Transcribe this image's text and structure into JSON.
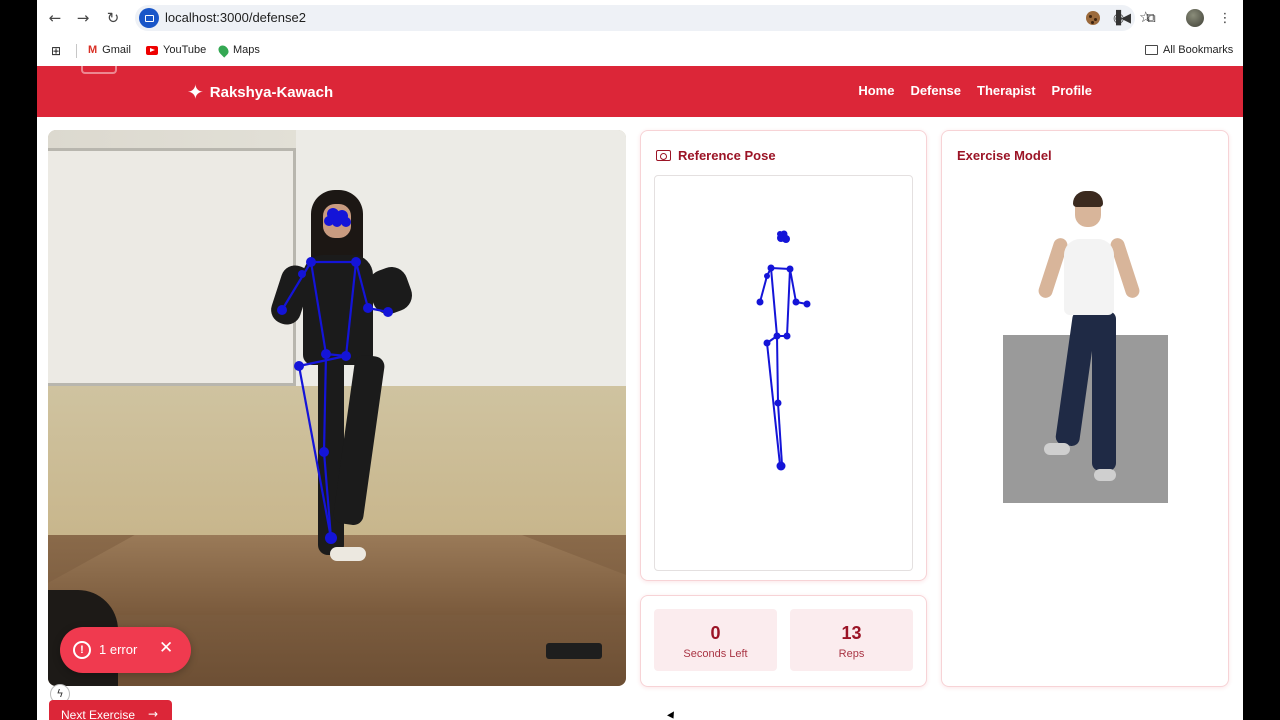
{
  "browser": {
    "url": "localhost:3000/defense2",
    "bookmarks": [
      {
        "label": "Gmail",
        "icon": "gmail-icon"
      },
      {
        "label": "YouTube",
        "icon": "youtube-icon"
      },
      {
        "label": "Maps",
        "icon": "maps-icon"
      }
    ],
    "all_bookmarks_label": "All Bookmarks"
  },
  "app": {
    "brand": "Rakshya-Kawach",
    "brand_icon": "martial-arts-icon",
    "nav": [
      "Home",
      "Defense",
      "Therapist",
      "Profile"
    ],
    "accent_color": "#dc2638",
    "title_color": "#9b1426"
  },
  "camera": {
    "error_label": "1 error",
    "next_label": "Next Exercise"
  },
  "reference": {
    "title": "Reference Pose"
  },
  "stats": [
    {
      "value": "0",
      "label": "Seconds Left"
    },
    {
      "value": "13",
      "label": "Reps"
    }
  ],
  "model": {
    "title": "Exercise Model"
  }
}
